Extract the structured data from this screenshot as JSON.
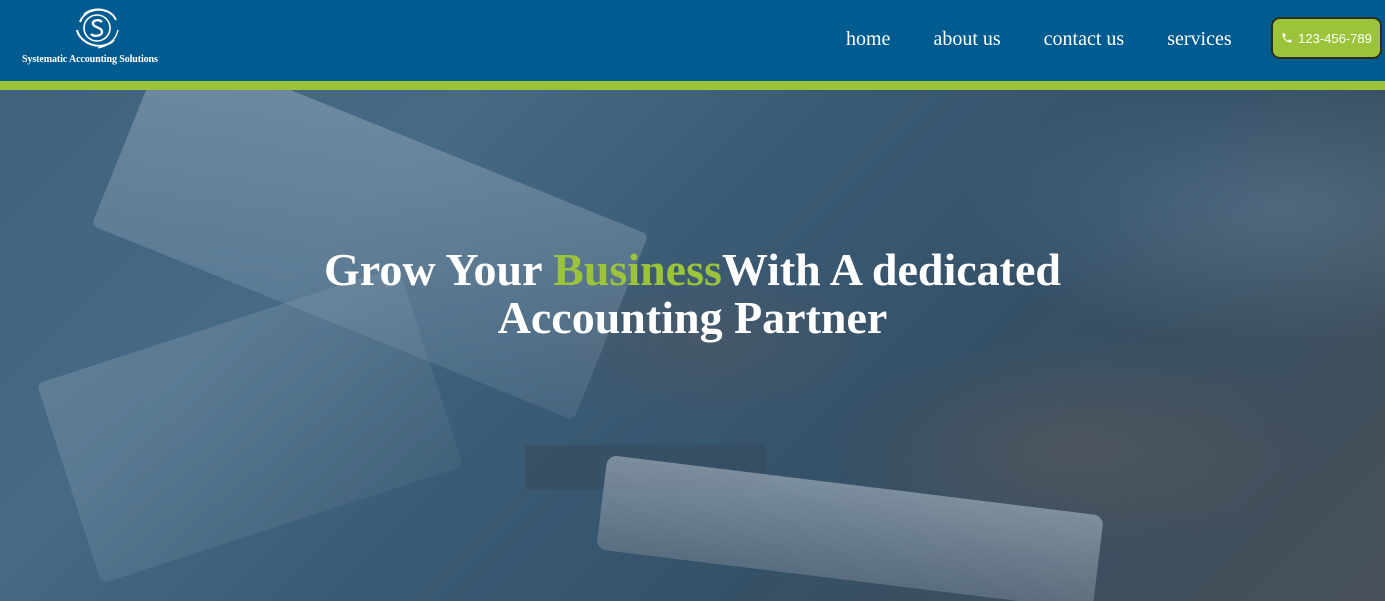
{
  "brand": {
    "name": "Systematic Accounting Solutions",
    "logo_icon": "swirl-s-logo-icon"
  },
  "nav": {
    "items": [
      {
        "label": "home"
      },
      {
        "label": "about us"
      },
      {
        "label": "contact us"
      },
      {
        "label": "services"
      }
    ]
  },
  "phone": {
    "label": "123-456-789",
    "icon": "phone-icon"
  },
  "hero": {
    "heading_part1": "Grow Your ",
    "heading_highlight": "Business",
    "heading_part2": "With A dedicated",
    "heading_line2": "Accounting Partner"
  },
  "colors": {
    "nav_background": "#005b91",
    "accent_green": "#9bc43a",
    "text_white": "#ffffff"
  }
}
